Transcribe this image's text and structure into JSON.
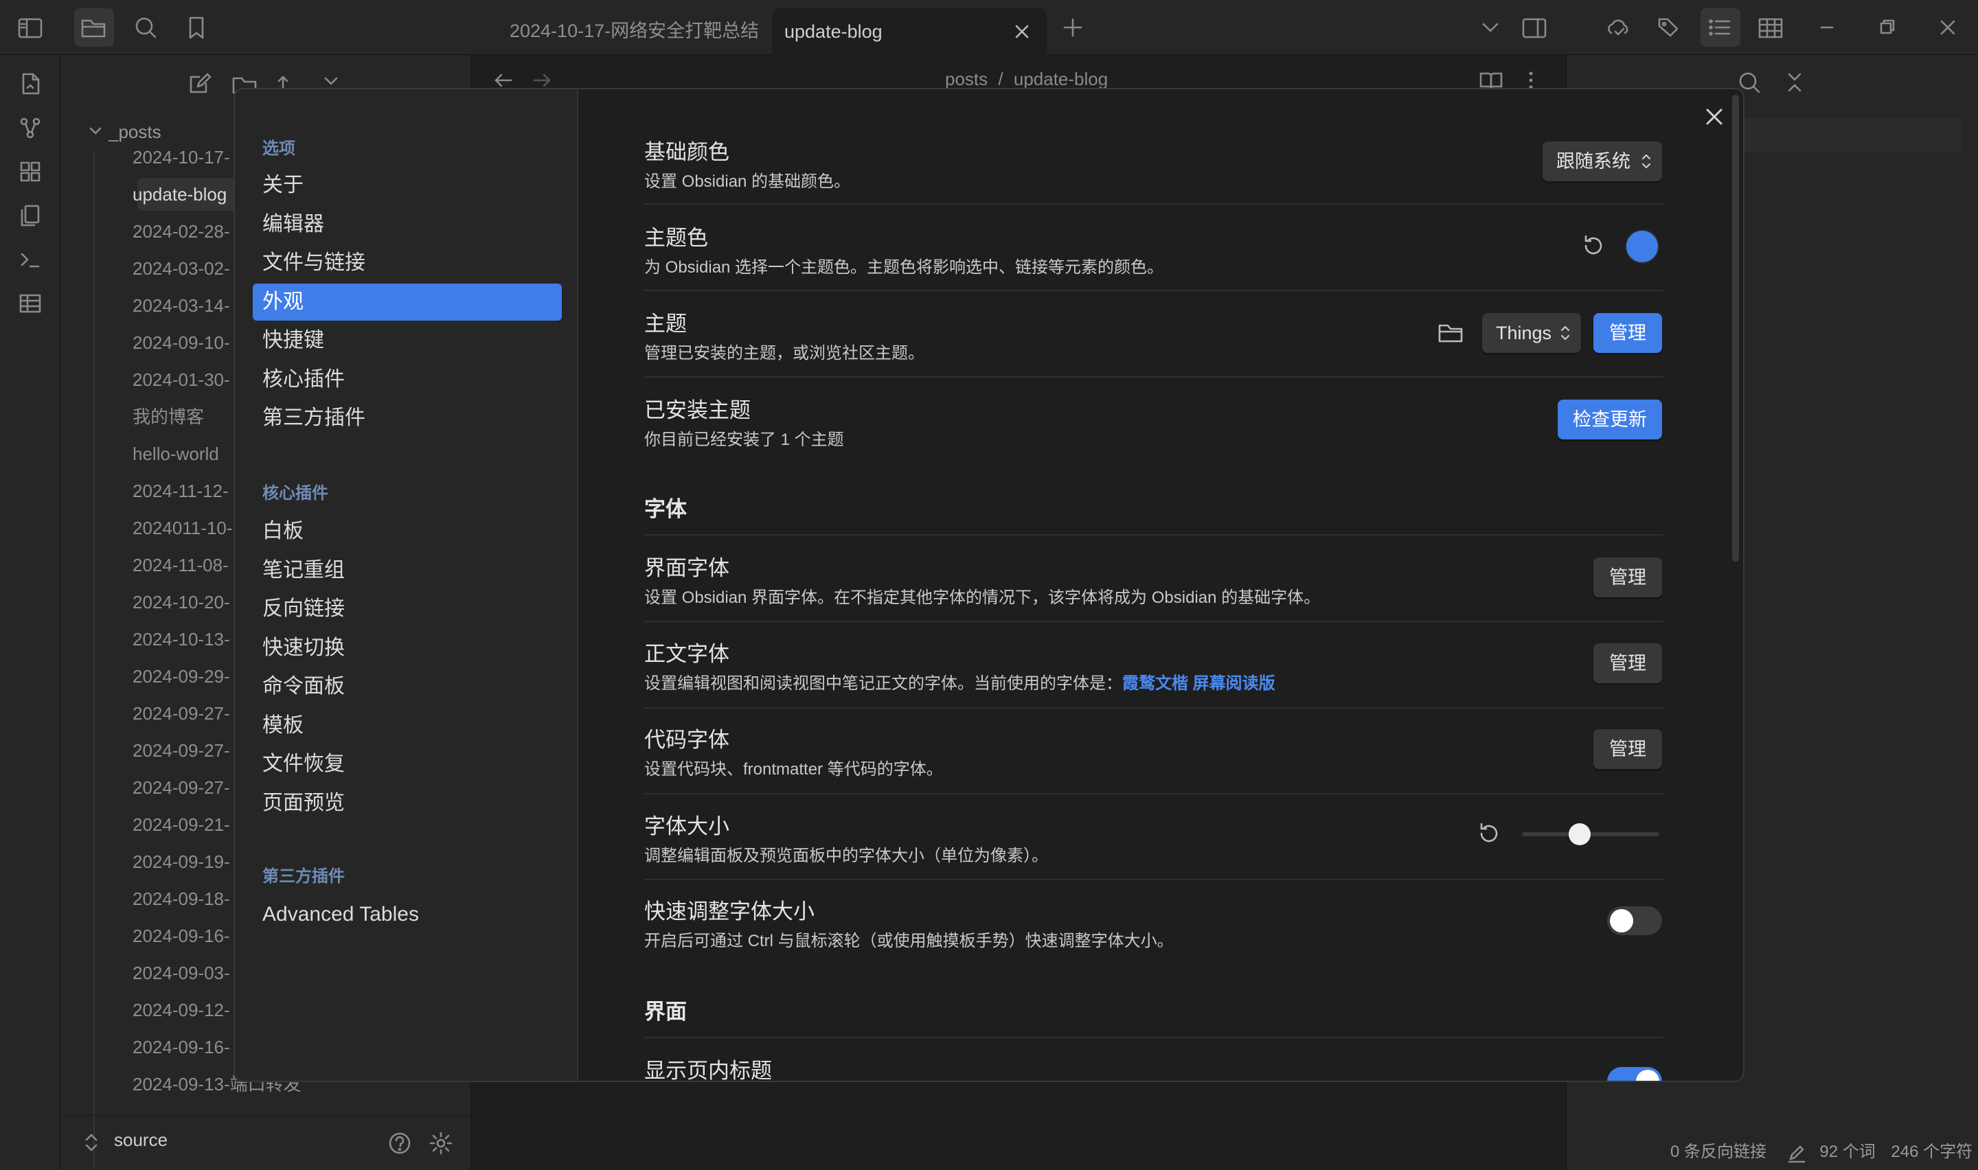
{
  "tabs": [
    {
      "label": "2024-10-17-网络安全打靶总结"
    },
    {
      "label": "update-blog"
    }
  ],
  "editor": {
    "breadcrumb_parent": "posts",
    "breadcrumb_sep": "/",
    "breadcrumb_current": "update-blog"
  },
  "explorer": {
    "root_folder": "_posts",
    "items": [
      "2024-10-17-",
      "update-blog",
      "2024-02-28-",
      "2024-03-02-",
      "2024-03-14-",
      "2024-09-10-",
      "2024-01-30-",
      "我的博客",
      "hello-world",
      "2024-11-12-",
      "2024011-10-",
      "2024-11-08-",
      "2024-10-20-",
      "2024-10-13-",
      "2024-09-29-",
      "2024-09-27-",
      "2024-09-27-",
      "2024-09-27-",
      "2024-09-21-",
      "2024-09-19-",
      "2024-09-18-",
      "2024-09-16-",
      "2024-09-03-",
      "2024-09-12-",
      "2024-09-16-",
      "2024-09-13-端口转发"
    ],
    "vault_name": "source"
  },
  "status": {
    "backlinks": "0 条反向链接",
    "words": "92 个词",
    "chars": "246 个字符"
  },
  "settings": {
    "nav": {
      "options_header": "选项",
      "options": [
        "关于",
        "编辑器",
        "文件与链接",
        "外观",
        "快捷键",
        "核心插件",
        "第三方插件"
      ],
      "core_header": "核心插件",
      "core": [
        "白板",
        "笔记重组",
        "反向链接",
        "快速切换",
        "命令面板",
        "模板",
        "文件恢复",
        "页面预览"
      ],
      "third_header": "第三方插件",
      "third": [
        "Advanced Tables"
      ]
    },
    "active_nav": "外观",
    "rows": {
      "base_color": {
        "title": "基础颜色",
        "desc": "设置 Obsidian 的基础颜色。",
        "value": "跟随系统"
      },
      "accent": {
        "title": "主题色",
        "desc": "为 Obsidian 选择一个主题色。主题色将影响选中、链接等元素的颜色。",
        "color": "#3f7ee8"
      },
      "theme": {
        "title": "主题",
        "desc": "管理已安装的主题，或浏览社区主题。",
        "value": "Things",
        "button": "管理"
      },
      "installed": {
        "title": "已安装主题",
        "desc": "你目前已经安装了 1 个主题",
        "button": "检查更新"
      },
      "font_section": "字体",
      "ui_font": {
        "title": "界面字体",
        "desc": "设置 Obsidian 界面字体。在不指定其他字体的情况下，该字体将成为 Obsidian 的基础字体。",
        "button": "管理"
      },
      "text_font": {
        "title": "正文字体",
        "desc": "设置编辑视图和阅读视图中笔记正文的字体。当前使用的字体是：",
        "font_name": "霞鹜文楷 屏幕阅读版",
        "button": "管理"
      },
      "mono_font": {
        "title": "代码字体",
        "desc": "设置代码块、frontmatter 等代码的字体。",
        "button": "管理"
      },
      "font_size": {
        "title": "字体大小",
        "desc": "调整编辑面板及预览面板中的字体大小（单位为像素）。",
        "slider_fraction": 0.42
      },
      "quick_font": {
        "title": "快速调整字体大小",
        "desc": "开启后可通过 Ctrl 与鼠标滚轮（或使用触摸板手势）快速调整字体大小。",
        "enabled": false
      },
      "ui_section": "界面",
      "inline_title": {
        "title": "显示页内标题",
        "enabled": true
      }
    }
  }
}
